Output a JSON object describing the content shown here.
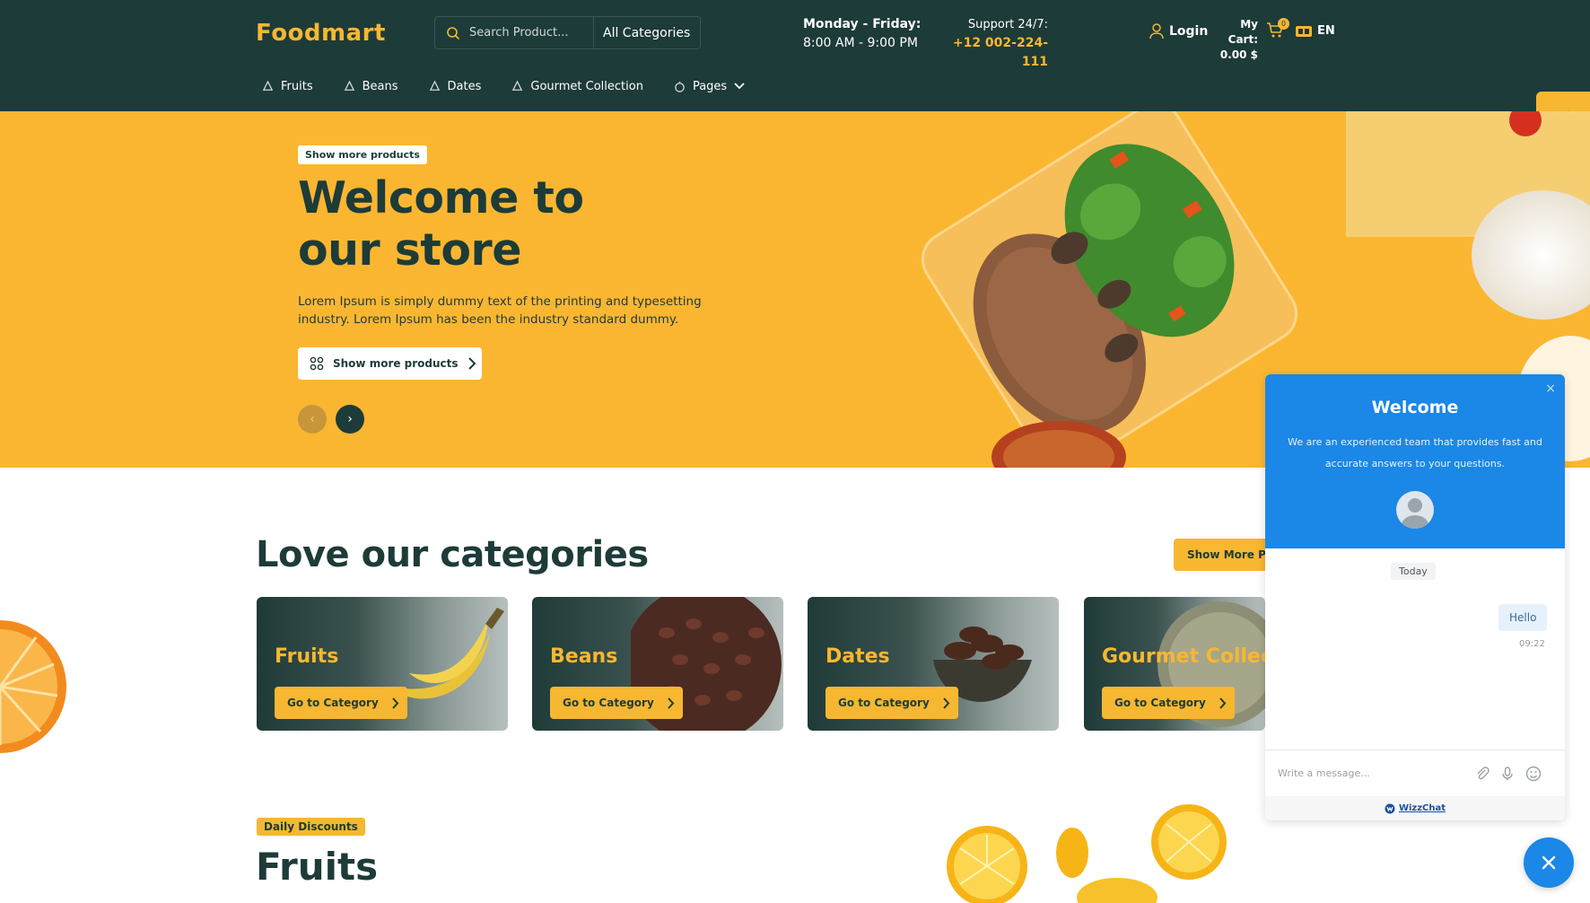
{
  "header": {
    "logo": "Foodmart",
    "search": {
      "placeholder": "Search Product...",
      "category": "All Categories"
    },
    "hours": {
      "days": "Monday - Friday:",
      "time": "8:00 AM - 9:00 PM"
    },
    "support": {
      "label": "Support 24/7:",
      "phone": "+12 002-224-111"
    },
    "login": "Login",
    "cart": {
      "label": "My Cart:",
      "total": "0.00 $",
      "count": "0"
    },
    "language": "EN",
    "colors": {
      "bg": "#1d3b38",
      "accent": "#f7b731"
    }
  },
  "nav": [
    {
      "label": "Fruits",
      "icon": "drop-icon"
    },
    {
      "label": "Beans",
      "icon": "drop-icon"
    },
    {
      "label": "Dates",
      "icon": "drop-icon"
    },
    {
      "label": "Gourmet Collection",
      "icon": "drop-icon"
    },
    {
      "label": "Pages",
      "icon": "stopwatch-icon"
    }
  ],
  "hero": {
    "badge": "Show more products",
    "title_line1": "Welcome to",
    "title_line2": "our store",
    "text": "Lorem Ipsum is simply dummy text of the printing and typesetting industry. Lorem Ipsum has been the industry standard dummy.",
    "button": "Show more products",
    "prev": "‹",
    "next": "›"
  },
  "categories": {
    "title": "Love our categories",
    "more_button": "Show More Products",
    "items": [
      {
        "name": "Fruits",
        "button": "Go to Category"
      },
      {
        "name": "Beans",
        "button": "Go to Category"
      },
      {
        "name": "Dates",
        "button": "Go to Category"
      },
      {
        "name": "Gourmet Collection",
        "button": "Go to Category"
      }
    ]
  },
  "discounts": {
    "badge": "Daily Discounts",
    "title": "Fruits"
  },
  "chat": {
    "close": "×",
    "welcome": "Welcome",
    "description": "We are an experienced team that provides fast and accurate answers to your questions.",
    "today": "Today",
    "message": "Hello",
    "time": "09:22",
    "placeholder": "Write a message...",
    "brand": "WizzChat",
    "accent": "#1b87e6"
  }
}
